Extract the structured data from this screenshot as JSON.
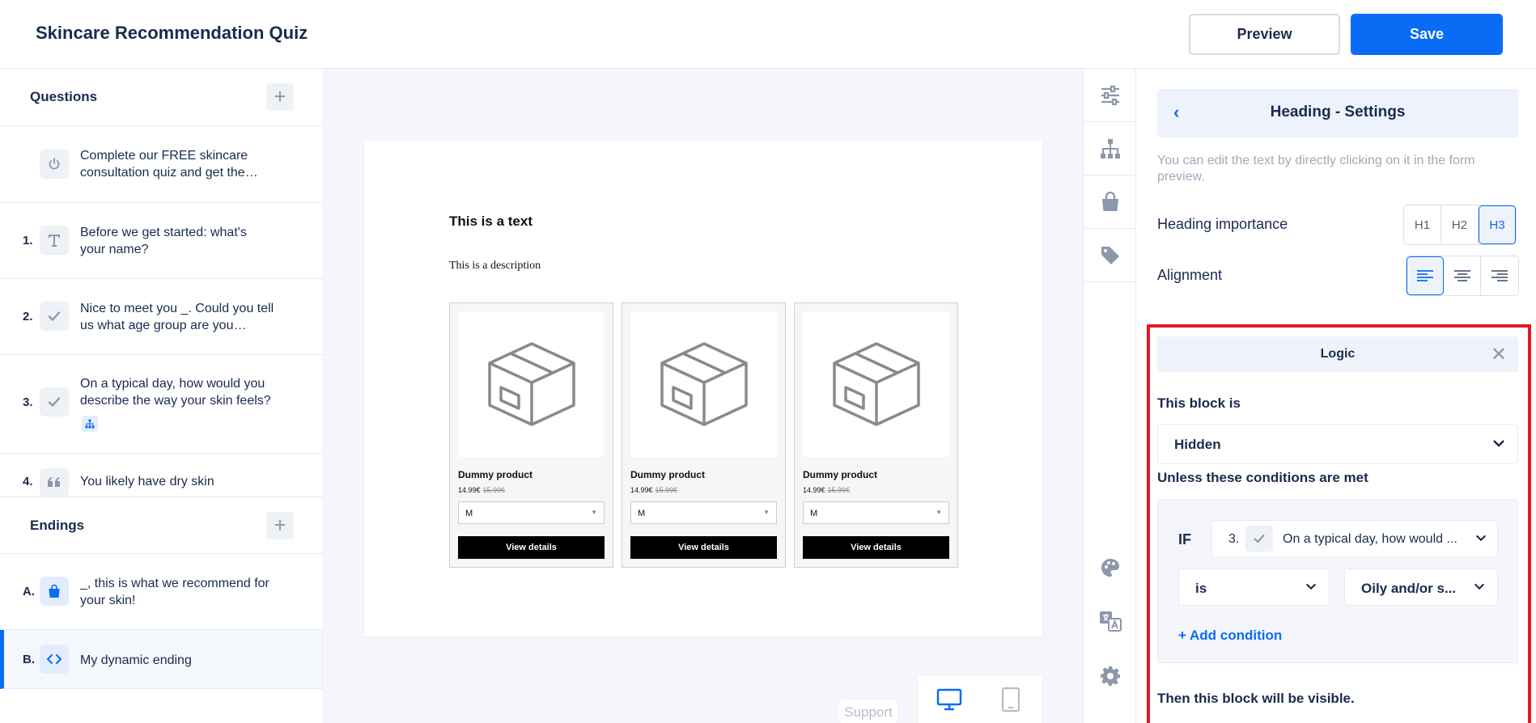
{
  "header": {
    "title": "Skincare Recommendation Quiz",
    "preview_label": "Preview",
    "save_label": "Save"
  },
  "questions": {
    "title": "Questions",
    "items": [
      {
        "num": "",
        "icon": "power-icon",
        "text": "Complete our FREE skincare consultation quiz and get the…"
      },
      {
        "num": "1.",
        "icon": "text-icon",
        "text": "Before we get started: what's your name?"
      },
      {
        "num": "2.",
        "icon": "check-icon",
        "text": "Nice to meet you _. Could you tell us what age group are you…"
      },
      {
        "num": "3.",
        "icon": "check-icon",
        "text": "On a typical day, how would you describe the way your skin feels?"
      },
      {
        "num": "4.",
        "icon": "quote-icon",
        "text": "You likely have dry skin"
      }
    ]
  },
  "endings": {
    "title": "Endings",
    "items": [
      {
        "num": "A.",
        "icon": "bag-icon",
        "text": "_, this is what we recommend for your skin!"
      },
      {
        "num": "B.",
        "icon": "code-icon",
        "text": "My dynamic ending"
      }
    ]
  },
  "preview": {
    "heading": "This is a text",
    "description": "This is a description",
    "products": [
      {
        "name": "Dummy product",
        "price": "14.99€",
        "old_price": "15.99€",
        "size": "M",
        "button": "View details"
      },
      {
        "name": "Dummy product",
        "price": "14.99€",
        "old_price": "15.99€",
        "size": "M",
        "button": "View details"
      },
      {
        "name": "Dummy product",
        "price": "14.99€",
        "old_price": "15.99€",
        "size": "M",
        "button": "View details"
      }
    ],
    "support_label": "Support"
  },
  "settings": {
    "title": "Heading - Settings",
    "help": "You can edit the text by directly clicking on it in the form preview.",
    "importance_label": "Heading importance",
    "importance_options": [
      "H1",
      "H2",
      "H3"
    ],
    "importance_selected": "H3",
    "alignment_label": "Alignment",
    "alignment_selected": "left"
  },
  "logic": {
    "title": "Logic",
    "block_is_label": "This block is",
    "block_state": "Hidden",
    "unless_label": "Unless these conditions are met",
    "if_label": "IF",
    "condition": {
      "question_num": "3.",
      "question_text": "On a typical day, how would ...",
      "operator": "is",
      "value": "Oily and/or s..."
    },
    "add_condition": "+ Add condition",
    "then_text": "Then this block will be visible."
  },
  "colors": {
    "accent": "#0a6cf5",
    "highlight": "#e01b24",
    "text": "#1a2b4f"
  }
}
